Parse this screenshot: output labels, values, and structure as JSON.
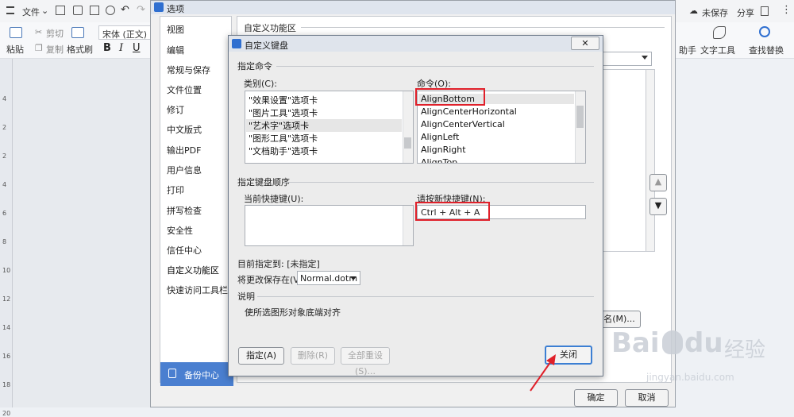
{
  "app_toolbar": {
    "file_label": "文件",
    "unsaved_label": "未保存",
    "share_label": "分享",
    "paste_label": "粘贴",
    "cut_label": "剪切",
    "copy_label": "复制",
    "format_painter_label": "格式刷",
    "font_name": "宋体 (正文)",
    "bold": "B",
    "italic": "I",
    "underline": "U",
    "text_tools_label": "文字工具",
    "find_replace_label": "查找替换",
    "helper_fragment": "助手"
  },
  "ruler_numbers": [
    "4",
    "2",
    "2",
    "4",
    "6",
    "8",
    "10",
    "12",
    "14",
    "16",
    "18",
    "20"
  ],
  "options_dialog": {
    "title": "选项",
    "nav": [
      "视图",
      "编辑",
      "常规与保存",
      "文件位置",
      "修订",
      "中文版式",
      "输出PDF",
      "用户信息",
      "打印",
      "拼写检查",
      "安全性",
      "信任中心",
      "自定义功能区",
      "快速访问工具栏"
    ],
    "selected_nav": "自定义功能区",
    "backup_label": "备份中心",
    "section_title": "自定义功能区",
    "partial_button": "名(M)...",
    "ok_label": "确定",
    "cancel_label": "取消"
  },
  "kbd_dialog": {
    "title": "自定义键盘",
    "specify_command": "指定命令",
    "category_label": "类别(C):",
    "categories": [
      "\"效果设置\"选项卡",
      "\"图片工具\"选项卡",
      "\"艺术字\"选项卡",
      "\"图形工具\"选项卡",
      "\"文档助手\"选项卡"
    ],
    "selected_category": "\"艺术字\"选项卡",
    "command_label": "命令(O):",
    "commands": [
      "AlignBottom",
      "AlignCenterHorizontal",
      "AlignCenterVertical",
      "AlignLeft",
      "AlignRight",
      "AlignTop"
    ],
    "selected_command": "AlignBottom",
    "key_sequence_label": "指定键盘顺序",
    "current_keys_label": "当前快捷键(U):",
    "new_key_label": "请按新快捷键(N):",
    "new_key_value": "Ctrl + Alt + A",
    "currently_assigned": "目前指定到: [未指定]",
    "save_changes_label": "将更改保存在(V):",
    "save_target": "Normal.dotm",
    "description_label": "说明",
    "description_text": "使所选图形对象底端对齐",
    "assign_label": "指定(A)",
    "remove_label": "删除(R)",
    "reset_all_label": "全部重设(S)...",
    "close_label": "关闭"
  },
  "watermark": {
    "brand": "Bai",
    "brand2": "du",
    "suffix": "经验",
    "url": "jingyan.baidu.com"
  },
  "colors": {
    "highlight_red": "#e0202a",
    "backup_blue": "#4a7fd0",
    "close_focus": "#3c7fd3"
  }
}
